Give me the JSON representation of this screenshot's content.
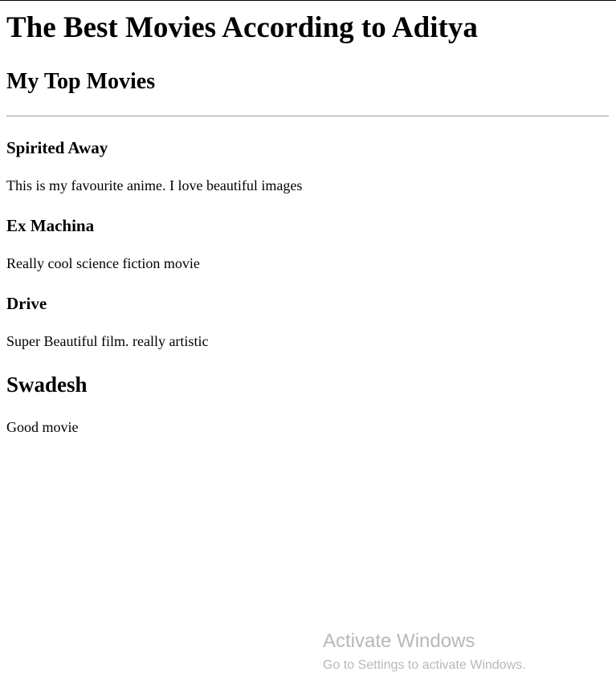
{
  "page": {
    "title": "The Best Movies According to Aditya",
    "subtitle": "My Top Movies"
  },
  "movies": [
    {
      "title": "Spirited Away",
      "description": "This is my favourite anime. I love beautiful images"
    },
    {
      "title": "Ex Machina",
      "description": "Really cool science fiction movie"
    },
    {
      "title": "Drive",
      "description": "Super Beautiful film. really artistic"
    },
    {
      "title": "Swadesh",
      "description": "Good movie"
    }
  ],
  "watermark": {
    "title": "Activate Windows",
    "subtitle": "Go to Settings to activate Windows."
  },
  "colors": {
    "text": "#000000",
    "divider": "#9a9a9a",
    "watermark": "#b8b8b8"
  }
}
